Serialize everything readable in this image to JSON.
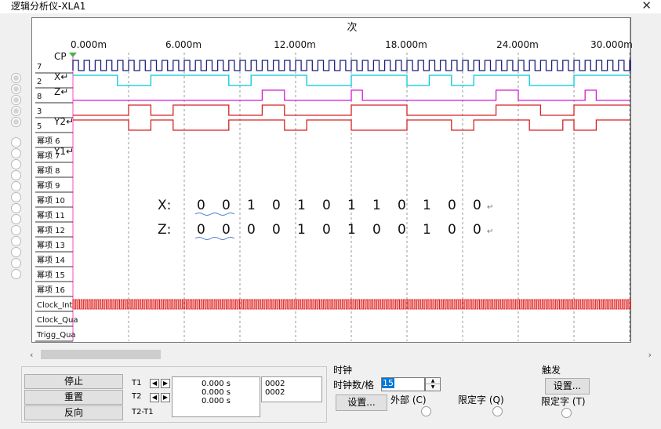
{
  "window": {
    "title": "逻辑分析仪-XLA1",
    "close_glyph": "✕"
  },
  "scope": {
    "top_label": "次",
    "time_ticks": [
      "0.000m",
      "6.000m",
      "12.000m",
      "18.000m",
      "24.000m",
      "30.000m"
    ],
    "channels": [
      {
        "num": "7",
        "note": "CP"
      },
      {
        "num": "2",
        "note": "X↵"
      },
      {
        "num": "8",
        "note": "Z↵"
      },
      {
        "num": "3",
        "note": ""
      },
      {
        "num": "5",
        "note": "Y2↵"
      },
      {
        "num": "幂项 6",
        "note": ""
      },
      {
        "num": "幂项 7",
        "note": "Y1↵"
      },
      {
        "num": "幂项 8",
        "note": ""
      },
      {
        "num": "幂项 9",
        "note": ""
      },
      {
        "num": "幂项 10",
        "note": ""
      },
      {
        "num": "幂项 11",
        "note": ""
      },
      {
        "num": "幂项 12",
        "note": ""
      },
      {
        "num": "幂项 13",
        "note": ""
      },
      {
        "num": "幂项 14",
        "note": ""
      },
      {
        "num": "幂项 15",
        "note": ""
      },
      {
        "num": "幂项 16",
        "note": ""
      },
      {
        "num": "Clock_Int",
        "note": ""
      },
      {
        "num": "Clock_Qua",
        "note": ""
      },
      {
        "num": "Trigg_Qua",
        "note": ""
      }
    ],
    "x_sequence": {
      "label": "X:",
      "digits": [
        "0",
        "0",
        "1",
        "0",
        "1",
        "0",
        "1",
        "1",
        "0",
        "1",
        "0",
        "0"
      ],
      "end": "↵"
    },
    "z_sequence": {
      "label": "Z:",
      "digits": [
        "0",
        "0",
        "0",
        "0",
        "1",
        "0",
        "1",
        "0",
        "0",
        "1",
        "0",
        "0"
      ],
      "end": "↵"
    },
    "colors": {
      "clock": "#1f1f7a",
      "x": "#00c8d8",
      "z": "#d11cd1",
      "ch3": "#d42323",
      "ch5": "#d42323",
      "clock_int": "#e02020",
      "cursor": "#ff66cc"
    }
  },
  "controls": {
    "stop": "停止",
    "reset": "重置",
    "reverse": "反向",
    "t1_label": "T1",
    "t2_label": "T2",
    "t2t1_label": "T2-T1",
    "arrow_left": "◀",
    "arrow_right": "▶",
    "times": [
      "0.000 s",
      "0.000 s",
      "0.000 s"
    ],
    "values": [
      "0002",
      "0002"
    ]
  },
  "clock": {
    "group_label": "时钟",
    "per_div_label": "时钟数/格",
    "per_div_value": "15",
    "setup_button": "设置...",
    "external_label": "外部 (C)",
    "qualifier_label": "限定字 (Q)"
  },
  "trigger": {
    "group_label": "触发",
    "setup_button": "设置...",
    "qualifier_label": "限定字 (T)"
  },
  "scroll": {
    "left_arrow": "‹",
    "right_arrow": "›"
  }
}
